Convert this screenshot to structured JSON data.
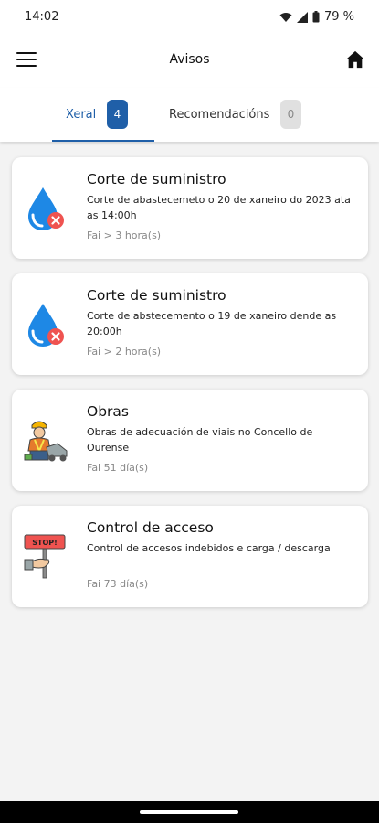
{
  "status_bar": {
    "time": "14:02",
    "battery": "79 %"
  },
  "app_bar": {
    "title": "Avisos",
    "menu_icon": "menu-icon",
    "home_icon": "home-icon"
  },
  "tabs": [
    {
      "label": "Xeral",
      "count": "4",
      "active": true
    },
    {
      "label": "Recomendacións",
      "count": "0",
      "active": false
    }
  ],
  "notices": [
    {
      "icon": "water-drop-cut-icon",
      "title": "Corte de suministro",
      "description": "Corte de abastecemeto o 20  de xaneiro do 2023 ata as 14:00h",
      "time": "Fai > 3 hora(s)"
    },
    {
      "icon": "water-drop-cut-icon",
      "title": "Corte de suministro",
      "description": "Corte de abstecemento o 19 de xaneiro dende as 20:00h",
      "time": "Fai > 2 hora(s)"
    },
    {
      "icon": "construction-worker-icon",
      "title": "Obras",
      "description": "Obras de adecuación de viais no Concello de Ourense",
      "time": "Fai 51 día(s)"
    },
    {
      "icon": "stop-sign-icon",
      "title": "Control de acceso",
      "description": "Control de accesos indebidos e carga / descarga",
      "time": "Fai 73 día(s)"
    }
  ],
  "stop_sign_text": "STOP!",
  "colors": {
    "accent": "#1f5fa8",
    "water": "#1e88e5",
    "alert": "#ef5350"
  }
}
